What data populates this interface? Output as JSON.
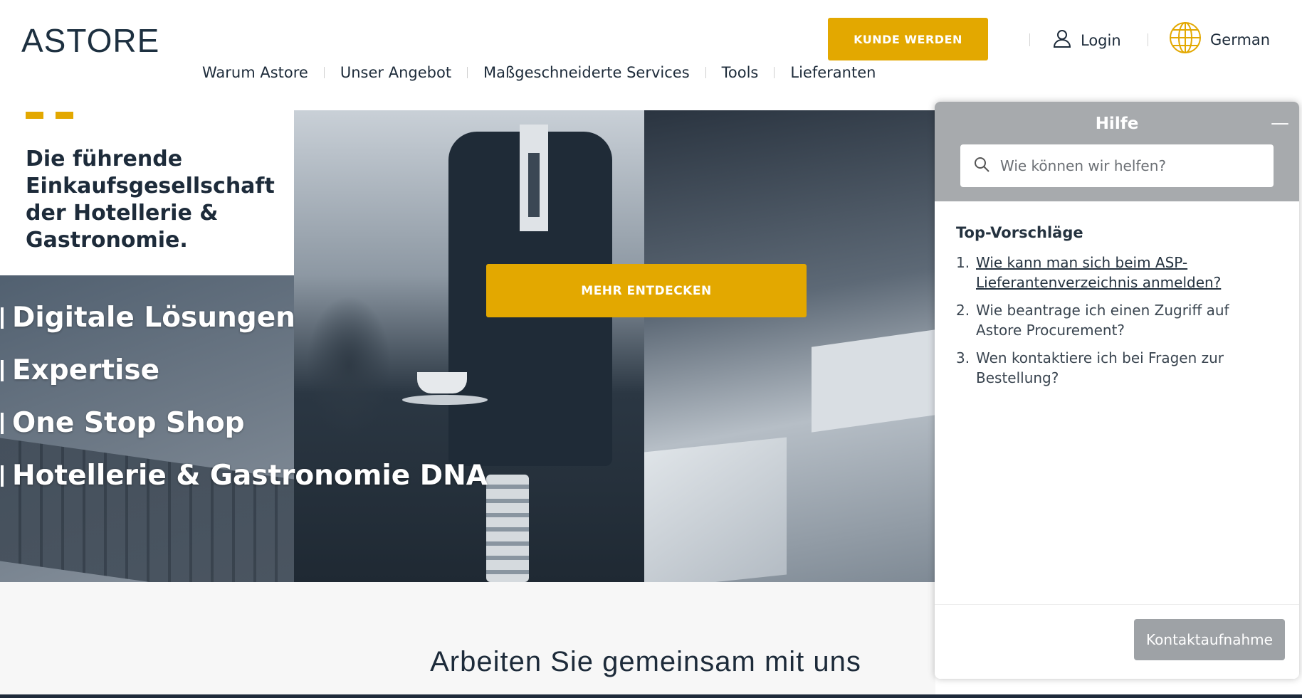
{
  "header": {
    "logo": "ASTORE",
    "cta_label": "KUNDE WERDEN",
    "login_label": "Login",
    "language_label": "German",
    "nav": [
      "Warum Astore",
      "Unser Angebot",
      "Maßgeschneiderte Services",
      "Tools",
      "Lieferanten"
    ]
  },
  "hero": {
    "title": "Die führende Einkaufsgesellschaft der Hotellerie & Gastronomie.",
    "bullets": [
      "Digitale Lösungen",
      "Expertise",
      "One Stop Shop",
      "Hotellerie & Gastronomie DNA"
    ],
    "cta_label": "MEHR ENTDECKEN"
  },
  "section": {
    "title": "Arbeiten Sie gemeinsam mit uns"
  },
  "help": {
    "title": "Hilfe",
    "minimize_icon": "minus-icon",
    "search_placeholder": "Wie können wir helfen?",
    "suggestions_heading": "Top-Vorschläge",
    "suggestions": [
      {
        "num": "1.",
        "text": "Wie kann man sich beim ASP-Lieferantenverzeichnis anmelden?"
      },
      {
        "num": "2.",
        "text": "Wie beantrage ich einen Zugriff auf Astore Procurement?"
      },
      {
        "num": "3.",
        "text": "Wen kontaktiere ich bei Fragen zur Bestellung?"
      }
    ],
    "contact_label": "Kontaktaufnahme"
  },
  "colors": {
    "accent": "#e3a800",
    "text_dark": "#1d2b3a",
    "help_header": "#a7aaad",
    "help_button": "#9ea2a6"
  }
}
